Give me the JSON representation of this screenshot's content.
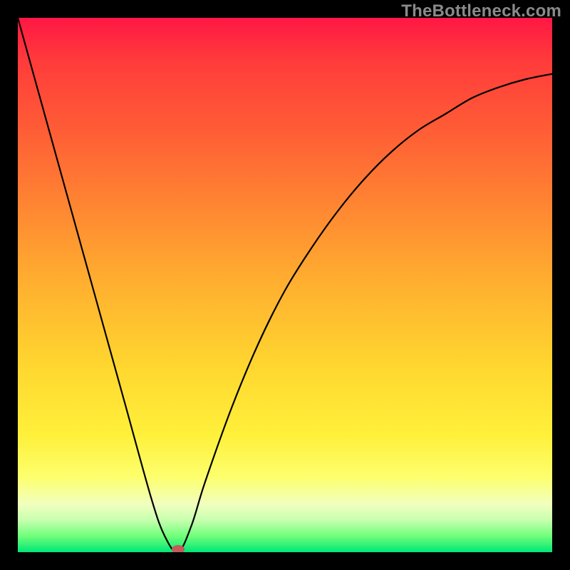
{
  "watermark": "TheBottleneck.com",
  "chart_data": {
    "type": "line",
    "title": "",
    "xlabel": "",
    "ylabel": "",
    "xlim": [
      0,
      100
    ],
    "ylim": [
      0,
      100
    ],
    "x": [
      0,
      5,
      10,
      15,
      20,
      25,
      27.5,
      30,
      32.5,
      35,
      40,
      45,
      50,
      55,
      60,
      65,
      70,
      75,
      80,
      85,
      90,
      95,
      100
    ],
    "values": [
      100,
      82,
      64,
      46,
      28,
      10,
      3,
      0,
      5,
      13,
      27,
      39,
      49,
      57,
      64,
      70,
      75,
      79,
      82,
      85,
      87,
      88.5,
      89.5
    ],
    "minimum": {
      "x": 30,
      "y": 0
    },
    "description": "V-shaped bottleneck curve: steep linear descent from 100% at left edge to a minimum near x≈30, then an asymptotically-rising curve approaching ~90% on the right. Vertical gradient background indicates quality: red (top, bad) → green (bottom, good). Pink marker at the minimum."
  }
}
